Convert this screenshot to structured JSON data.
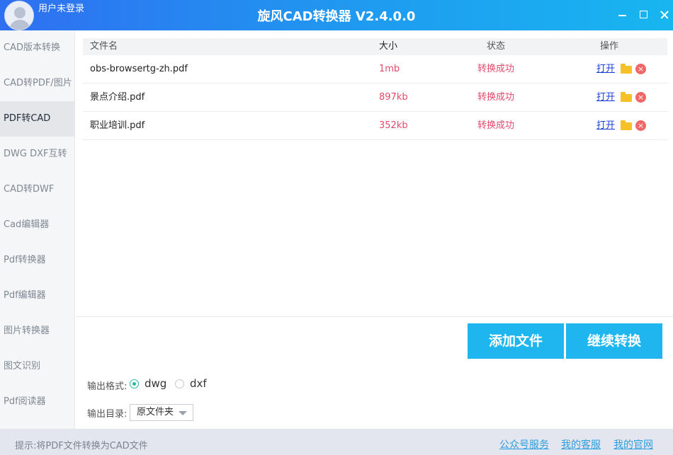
{
  "titlebar": {
    "user_label": "用户未登录",
    "app_title": "旋风CAD转换器 V2.4.0.0"
  },
  "sidebar": {
    "items": [
      {
        "label": "CAD版本转换"
      },
      {
        "label": "CAD转PDF/图片"
      },
      {
        "label": "PDF转CAD",
        "active": true
      },
      {
        "label": "DWG DXF互转"
      },
      {
        "label": "CAD转DWF"
      },
      {
        "label": "Cad编辑器"
      },
      {
        "label": "Pdf转换器"
      },
      {
        "label": "Pdf编辑器"
      },
      {
        "label": "图片转换器"
      },
      {
        "label": "图文识别"
      },
      {
        "label": "Pdf阅读器"
      }
    ]
  },
  "table": {
    "headers": {
      "name": "文件名",
      "size": "大小",
      "status": "状态",
      "op": "操作"
    },
    "rows": [
      {
        "name": "obs-browsertg-zh.pdf",
        "size": "1mb",
        "status": "转换成功",
        "open": "打开"
      },
      {
        "name": "景点介绍.pdf",
        "size": "897kb",
        "status": "转换成功",
        "open": "打开"
      },
      {
        "name": "职业培训.pdf",
        "size": "352kb",
        "status": "转换成功",
        "open": "打开"
      }
    ]
  },
  "actions": {
    "add_file": "添加文件",
    "continue_convert": "继续转换"
  },
  "output": {
    "format_label": "输出格式:",
    "format_options": [
      "dwg",
      "dxf"
    ],
    "format_selected": "dwg",
    "dir_label": "输出目录:",
    "dir_value": "原文件夹"
  },
  "statusbar": {
    "hint": "提示:将PDF文件转换为CAD文件",
    "links": [
      "公众号服务",
      "我的客服",
      "我的官网"
    ]
  },
  "colors": {
    "titlebar_start": "#2f6ff1",
    "titlebar_end": "#18b6f0",
    "accent_button": "#1fb6f0",
    "success_text": "#e8486a",
    "link": "#2d9fe0"
  }
}
